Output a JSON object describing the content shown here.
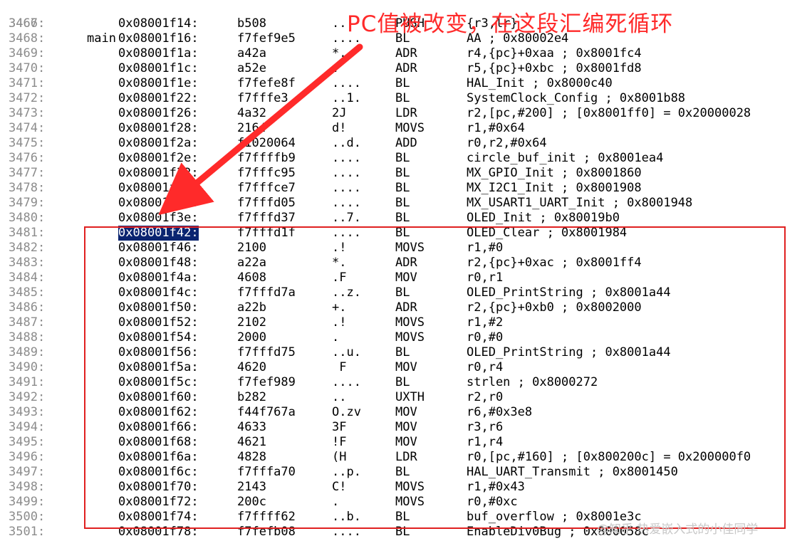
{
  "function_label": {
    "ln": "3466:",
    "name": "main"
  },
  "rows": [
    {
      "ln": "3467:",
      "addr": "0x08001f14:",
      "code": "b508",
      "ascii": "..",
      "mnem": "PUSH",
      "ops": "{r3,lr}"
    },
    {
      "ln": "3468:",
      "addr": "0x08001f16:",
      "code": "f7fef9e5",
      "ascii": "....",
      "mnem": "BL",
      "ops": "AA ; 0x80002e4"
    },
    {
      "ln": "3469:",
      "addr": "0x08001f1a:",
      "code": "a42a",
      "ascii": "*.",
      "mnem": "ADR",
      "ops": "r4,{pc}+0xaa ; 0x8001fc4"
    },
    {
      "ln": "3470:",
      "addr": "0x08001f1c:",
      "code": "a52e",
      "ascii": ".",
      "mnem": "ADR",
      "ops": "r5,{pc}+0xbc ; 0x8001fd8"
    },
    {
      "ln": "3471:",
      "addr": "0x08001f1e:",
      "code": "f7fefe8f",
      "ascii": "....",
      "mnem": "BL",
      "ops": "HAL_Init ; 0x8000c40"
    },
    {
      "ln": "3472:",
      "addr": "0x08001f22:",
      "code": "f7fffe3",
      "ascii": "..1.",
      "mnem": "BL",
      "ops": "SystemClock_Config ; 0x8001b88"
    },
    {
      "ln": "3473:",
      "addr": "0x08001f26:",
      "code": "4a32",
      "ascii": "2J",
      "mnem": "LDR",
      "ops": "r2,[pc,#200] ; [0x8001ff0] = 0x20000028"
    },
    {
      "ln": "3474:",
      "addr": "0x08001f28:",
      "code": "2164",
      "ascii": "d!",
      "mnem": "MOVS",
      "ops": "r1,#0x64"
    },
    {
      "ln": "3475:",
      "addr": "0x08001f2a:",
      "code": "f1020064",
      "ascii": "..d.",
      "mnem": "ADD",
      "ops": "r0,r2,#0x64"
    },
    {
      "ln": "3476:",
      "addr": "0x08001f2e:",
      "code": "f7ffffb9",
      "ascii": "....",
      "mnem": "BL",
      "ops": "circle_buf_init ; 0x8001ea4"
    },
    {
      "ln": "3477:",
      "addr": "0x08001f32:",
      "code": "f7fffc95",
      "ascii": "....",
      "mnem": "BL",
      "ops": "MX_GPIO_Init ; 0x8001860"
    },
    {
      "ln": "3478:",
      "addr": "0x08001f36:",
      "code": "f7fffce7",
      "ascii": "....",
      "mnem": "BL",
      "ops": "MX_I2C1_Init ; 0x8001908"
    },
    {
      "ln": "3479:",
      "addr": "0x08001f3a:",
      "code": "f7fffd05",
      "ascii": "....",
      "mnem": "BL",
      "ops": "MX_USART1_UART_Init ; 0x8001948"
    },
    {
      "ln": "3480:",
      "addr": "0x08001f3e:",
      "code": "f7fffd37",
      "ascii": "..7.",
      "mnem": "BL",
      "ops": "OLED_Init ; 0x80019b0"
    },
    {
      "ln": "3481:",
      "addr": "0x08001f42:",
      "code": "f7fffd1f",
      "ascii": "....",
      "mnem": "BL",
      "ops": "OLED_Clear ; 0x8001984",
      "selected": true
    },
    {
      "ln": "3482:",
      "addr": "0x08001f46:",
      "code": "2100",
      "ascii": ".!",
      "mnem": "MOVS",
      "ops": "r1,#0"
    },
    {
      "ln": "3483:",
      "addr": "0x08001f48:",
      "code": "a22a",
      "ascii": "*.",
      "mnem": "ADR",
      "ops": "r2,{pc}+0xac ; 0x8001ff4"
    },
    {
      "ln": "3484:",
      "addr": "0x08001f4a:",
      "code": "4608",
      "ascii": ".F",
      "mnem": "MOV",
      "ops": "r0,r1"
    },
    {
      "ln": "3485:",
      "addr": "0x08001f4c:",
      "code": "f7fffd7a",
      "ascii": "..z.",
      "mnem": "BL",
      "ops": "OLED_PrintString ; 0x8001a44"
    },
    {
      "ln": "3486:",
      "addr": "0x08001f50:",
      "code": "a22b",
      "ascii": "+.",
      "mnem": "ADR",
      "ops": "r2,{pc}+0xb0 ; 0x8002000"
    },
    {
      "ln": "3487:",
      "addr": "0x08001f52:",
      "code": "2102",
      "ascii": ".!",
      "mnem": "MOVS",
      "ops": "r1,#2"
    },
    {
      "ln": "3488:",
      "addr": "0x08001f54:",
      "code": "2000",
      "ascii": ".",
      "mnem": "MOVS",
      "ops": "r0,#0"
    },
    {
      "ln": "3489:",
      "addr": "0x08001f56:",
      "code": "f7fffd75",
      "ascii": "..u.",
      "mnem": "BL",
      "ops": "OLED_PrintString ; 0x8001a44"
    },
    {
      "ln": "3490:",
      "addr": "0x08001f5a:",
      "code": "4620",
      "ascii": " F",
      "mnem": "MOV",
      "ops": "r0,r4"
    },
    {
      "ln": "3491:",
      "addr": "0x08001f5c:",
      "code": "f7fef989",
      "ascii": "....",
      "mnem": "BL",
      "ops": "strlen ; 0x8000272"
    },
    {
      "ln": "3492:",
      "addr": "0x08001f60:",
      "code": "b282",
      "ascii": "..",
      "mnem": "UXTH",
      "ops": "r2,r0"
    },
    {
      "ln": "3493:",
      "addr": "0x08001f62:",
      "code": "f44f767a",
      "ascii": "O.zv",
      "mnem": "MOV",
      "ops": "r6,#0x3e8"
    },
    {
      "ln": "3494:",
      "addr": "0x08001f66:",
      "code": "4633",
      "ascii": "3F",
      "mnem": "MOV",
      "ops": "r3,r6"
    },
    {
      "ln": "3495:",
      "addr": "0x08001f68:",
      "code": "4621",
      "ascii": "!F",
      "mnem": "MOV",
      "ops": "r1,r4"
    },
    {
      "ln": "3496:",
      "addr": "0x08001f6a:",
      "code": "4828",
      "ascii": "(H",
      "mnem": "LDR",
      "ops": "r0,[pc,#160] ; [0x800200c] = 0x200000f0"
    },
    {
      "ln": "3497:",
      "addr": "0x08001f6c:",
      "code": "f7fffa70",
      "ascii": "..p.",
      "mnem": "BL",
      "ops": "HAL_UART_Transmit ; 0x8001450"
    },
    {
      "ln": "3498:",
      "addr": "0x08001f70:",
      "code": "2143",
      "ascii": "C!",
      "mnem": "MOVS",
      "ops": "r1,#0x43"
    },
    {
      "ln": "3499:",
      "addr": "0x08001f72:",
      "code": "200c",
      "ascii": ".",
      "mnem": "MOVS",
      "ops": "r0,#0xc"
    },
    {
      "ln": "3500:",
      "addr": "0x08001f74:",
      "code": "f7ffff62",
      "ascii": "..b.",
      "mnem": "BL",
      "ops": "buf_overflow ; 0x8001e3c"
    },
    {
      "ln": "3501:",
      "addr": "0x08001f78:",
      "code": "f7fefb08",
      "ascii": "....",
      "mnem": "BL",
      "ops": "EnableDiv0Bug ; 0x800058c"
    }
  ],
  "annotation": {
    "text": "PC值被改变，在这段汇编死循环",
    "color": "#ff2a2a"
  },
  "highlight_box_color": "#e02020",
  "selection_color": "#0a2470",
  "watermark": "@知乎 热爱嵌入式的小佳同学"
}
